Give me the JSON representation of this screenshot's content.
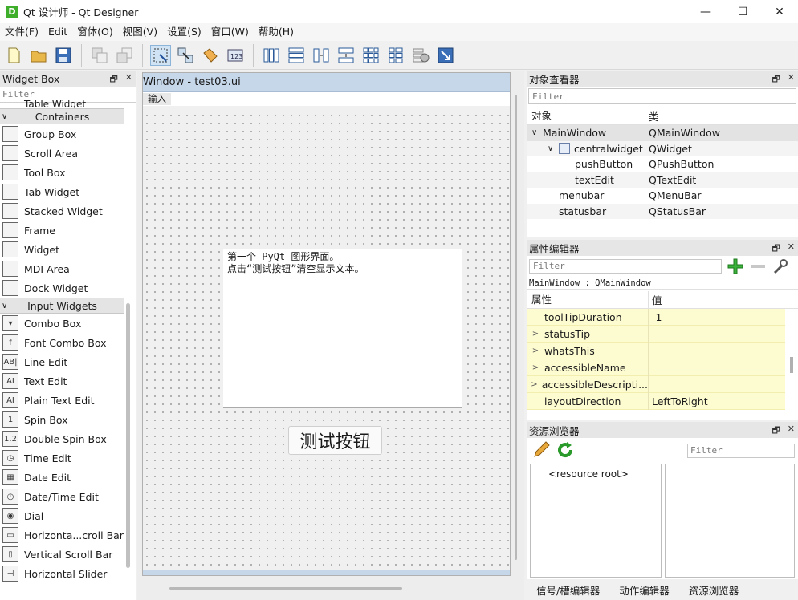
{
  "window": {
    "title": "Qt 设计师 - Qt Designer",
    "app_icon": "D",
    "minimize": "—",
    "maximize": "☐",
    "close": "✕"
  },
  "menu": [
    "文件(F)",
    "Edit",
    "窗体(O)",
    "视图(V)",
    "设置(S)",
    "窗口(W)",
    "帮助(H)"
  ],
  "widget_box": {
    "title": "Widget Box",
    "filter_placeholder": "Filter",
    "partial_item": "Table Widget",
    "containers_label": "Containers",
    "containers": [
      {
        "label": "Group Box",
        "icon": "group-box-icon"
      },
      {
        "label": "Scroll Area",
        "icon": "scroll-area-icon"
      },
      {
        "label": "Tool Box",
        "icon": "tool-box-icon"
      },
      {
        "label": "Tab Widget",
        "icon": "tab-widget-icon"
      },
      {
        "label": "Stacked Widget",
        "icon": "stacked-widget-icon"
      },
      {
        "label": "Frame",
        "icon": "frame-icon"
      },
      {
        "label": "Widget",
        "icon": "widget-icon"
      },
      {
        "label": "MDI Area",
        "icon": "mdi-area-icon"
      },
      {
        "label": "Dock Widget",
        "icon": "dock-widget-icon"
      }
    ],
    "input_label": "Input Widgets",
    "inputs": [
      {
        "label": "Combo Box",
        "glyph": "▾"
      },
      {
        "label": "Font Combo Box",
        "glyph": "f"
      },
      {
        "label": "Line Edit",
        "glyph": "AB|"
      },
      {
        "label": "Text Edit",
        "glyph": "AI"
      },
      {
        "label": "Plain Text Edit",
        "glyph": "AI"
      },
      {
        "label": "Spin Box",
        "glyph": "1"
      },
      {
        "label": "Double Spin Box",
        "glyph": "1.2"
      },
      {
        "label": "Time Edit",
        "glyph": "◷"
      },
      {
        "label": "Date Edit",
        "glyph": "▦"
      },
      {
        "label": "Date/Time Edit",
        "glyph": "◷"
      },
      {
        "label": "Dial",
        "glyph": "◉"
      },
      {
        "label": "Horizonta...croll Bar",
        "glyph": "▭"
      },
      {
        "label": "Vertical Scroll Bar",
        "glyph": "▯"
      },
      {
        "label": "Horizontal Slider",
        "glyph": "⊣"
      }
    ]
  },
  "form": {
    "title": "Window - test03.ui",
    "menu_placeholder": "输入",
    "text_line1": "第一个 PyQt 图形界面。",
    "text_line2": "点击“测试按钮”清空显示文本。",
    "button_label": "测试按钮"
  },
  "object_inspector": {
    "title": "对象查看器",
    "filter_placeholder": "Filter",
    "col_object": "对象",
    "col_class": "类",
    "rows": [
      {
        "name": "MainWindow",
        "cls": "QMainWindow",
        "indent": 0,
        "expander": "∨"
      },
      {
        "name": "centralwidget",
        "cls": "QWidget",
        "indent": 1,
        "expander": "∨"
      },
      {
        "name": "pushButton",
        "cls": "QPushButton",
        "indent": 2,
        "expander": ""
      },
      {
        "name": "textEdit",
        "cls": "QTextEdit",
        "indent": 2,
        "expander": ""
      },
      {
        "name": "menubar",
        "cls": "QMenuBar",
        "indent": 1,
        "expander": ""
      },
      {
        "name": "statusbar",
        "cls": "QStatusBar",
        "indent": 1,
        "expander": ""
      }
    ]
  },
  "property_editor": {
    "title": "属性编辑器",
    "filter_placeholder": "Filter",
    "class_line": "MainWindow : QMainWindow",
    "col_property": "属性",
    "col_value": "值",
    "rows": [
      {
        "name": "toolTipDuration",
        "value": "-1",
        "expander": ""
      },
      {
        "name": "statusTip",
        "value": "",
        "expander": ">"
      },
      {
        "name": "whatsThis",
        "value": "",
        "expander": ">"
      },
      {
        "name": "accessibleName",
        "value": "",
        "expander": ">"
      },
      {
        "name": "accessibleDescripti...",
        "value": "",
        "expander": ">"
      },
      {
        "name": "layoutDirection",
        "value": "LeftToRight",
        "expander": ""
      }
    ]
  },
  "resource_browser": {
    "title": "资源浏览器",
    "filter_placeholder": "Filter",
    "root_label": "<resource root>"
  },
  "bottom_tabs": [
    "信号/槽编辑器",
    "动作编辑器",
    "资源浏览器"
  ],
  "dock_float": "🗗",
  "dock_close": "✕"
}
